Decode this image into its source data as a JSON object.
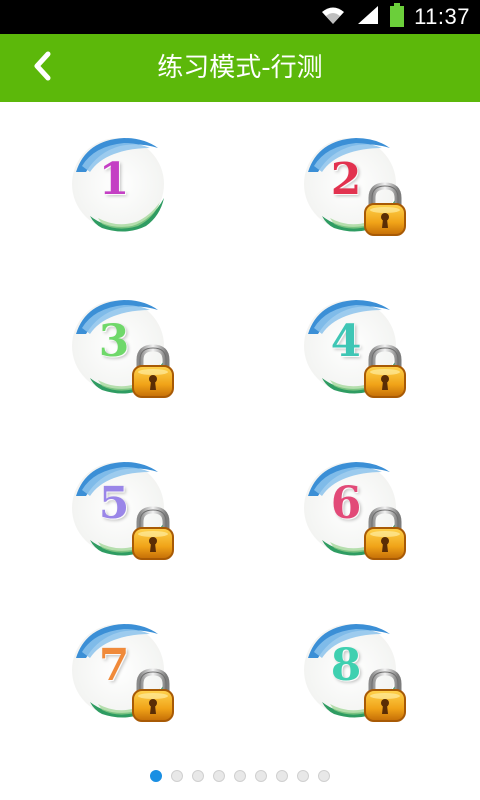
{
  "status_bar": {
    "time": "11:37",
    "icons": [
      "wifi-icon",
      "signal-icon",
      "battery-icon"
    ]
  },
  "header": {
    "title": "练习模式-行测",
    "back_icon": "chevron-left-icon",
    "color": "#5cb80a"
  },
  "levels": [
    {
      "number": "1",
      "locked": false,
      "color": "#c43fc4"
    },
    {
      "number": "2",
      "locked": true,
      "color": "#e2324f"
    },
    {
      "number": "3",
      "locked": true,
      "color": "#6fd86a"
    },
    {
      "number": "4",
      "locked": true,
      "color": "#3fc6b5"
    },
    {
      "number": "5",
      "locked": true,
      "color": "#9a86e8"
    },
    {
      "number": "6",
      "locked": true,
      "color": "#e24a78"
    },
    {
      "number": "7",
      "locked": true,
      "color": "#f08a3a"
    },
    {
      "number": "8",
      "locked": true,
      "color": "#3fd0b0"
    }
  ],
  "pager": {
    "count": 9,
    "active": 1,
    "active_color": "#1a8fe3"
  }
}
